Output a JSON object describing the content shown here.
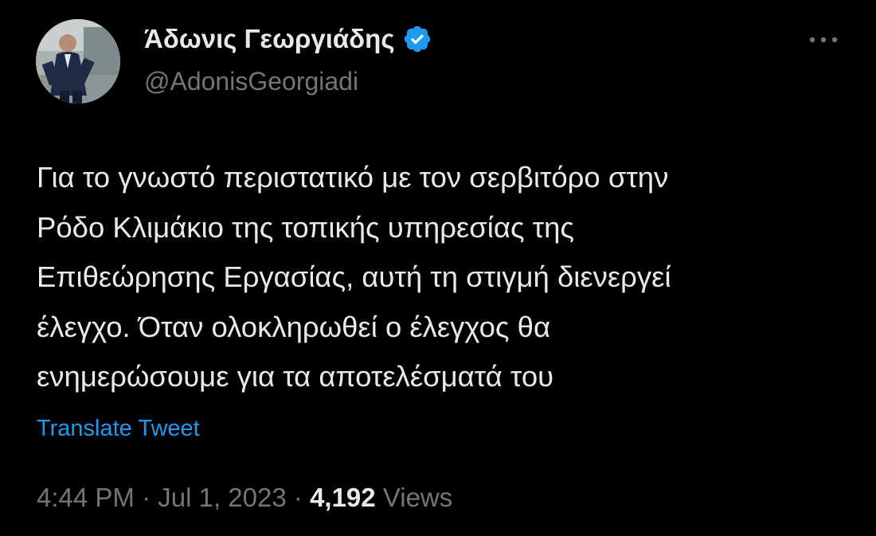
{
  "author": {
    "display_name": "Άδωνις Γεωργιάδης",
    "handle": "@AdonisGeorgiadi",
    "avatar_icon": "profile-photo",
    "verified_icon": "verified-badge-icon",
    "verified_color": "#1d9bf0"
  },
  "tweet": {
    "text": "Για το γνωστό περιστατικό με τον σερβιτόρο στην\nΡόδο Κλιμάκιο της τοπικής υπηρεσίας της\nΕπιθεώρησης Εργασίας, αυτή τη στιγμή διενεργεί\nέλεγχο. Όταν ολοκληρωθεί ο έλεγχος θα\nενημερώσουμε για τα αποτελέσματά του",
    "translate_label": "Translate Tweet",
    "time": "4:44 PM",
    "separator": "·",
    "date": "Jul 1, 2023",
    "views_count": "4,192",
    "views_label": "Views"
  },
  "colors": {
    "background": "#000000",
    "text": "#e7e9ea",
    "muted": "#71767b",
    "link": "#1d9bf0"
  },
  "menu": {
    "more_icon": "more-options-icon"
  }
}
